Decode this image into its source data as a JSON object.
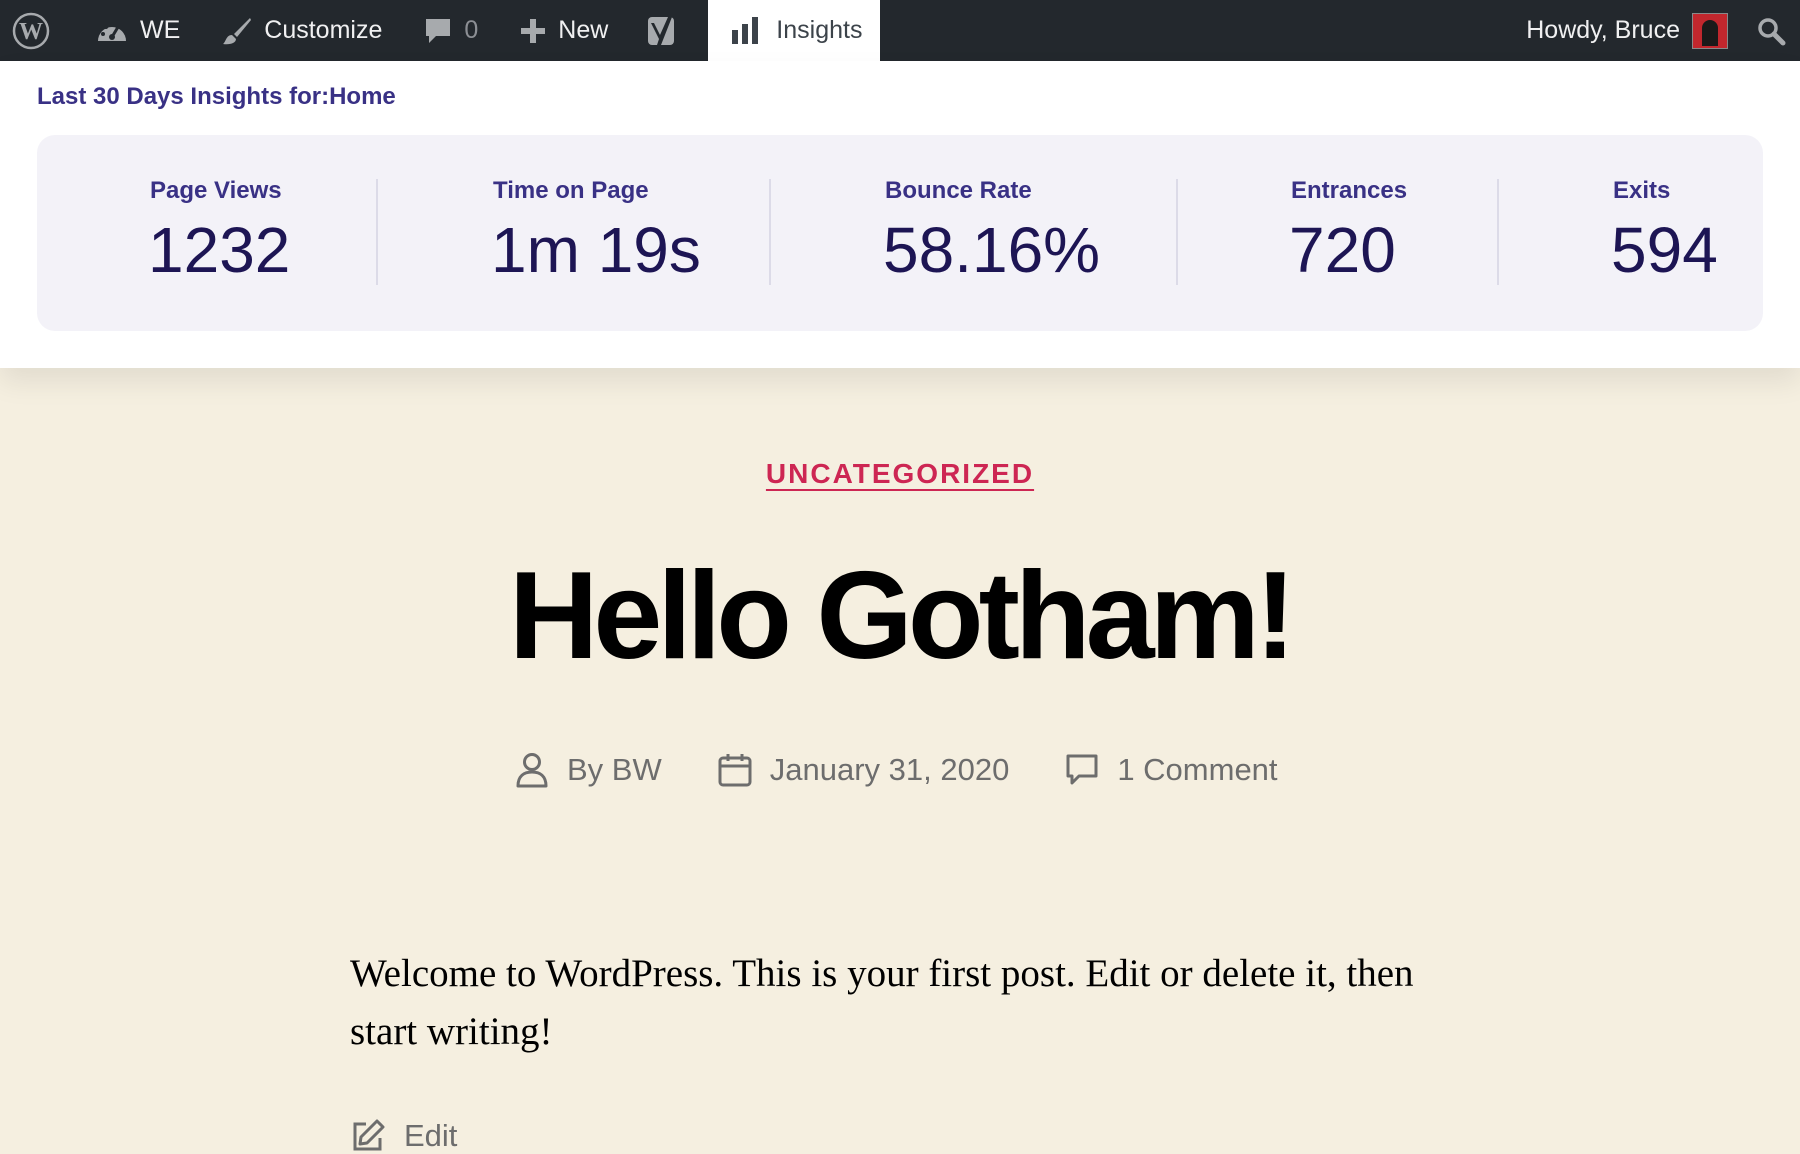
{
  "adminbar": {
    "site_name": "WE",
    "customize_label": "Customize",
    "comments_count": "0",
    "new_label": "New",
    "insights_label": "Insights",
    "greeting": "Howdy, Bruce"
  },
  "insights": {
    "heading": "Last 30 Days Insights for:Home",
    "stats": [
      {
        "label": "Page Views",
        "value": "1232"
      },
      {
        "label": "Time on Page",
        "value": "1m 19s"
      },
      {
        "label": "Bounce Rate",
        "value": "58.16%"
      },
      {
        "label": "Entrances",
        "value": "720"
      },
      {
        "label": "Exits",
        "value": "594"
      }
    ]
  },
  "post": {
    "category": "UNCATEGORIZED",
    "title": "Hello Gotham!",
    "author": "By BW",
    "date": "January 31, 2020",
    "comments": "1 Comment",
    "excerpt": "Welcome to WordPress. This is your first post. Edit or delete it, then start writing!",
    "edit_label": "Edit"
  },
  "colors": {
    "adminbar_bg": "#23282d",
    "insights_accent": "#393185",
    "stat_value": "#1d1554",
    "category_accent": "#cd2653",
    "page_bg": "#f5efe0"
  }
}
